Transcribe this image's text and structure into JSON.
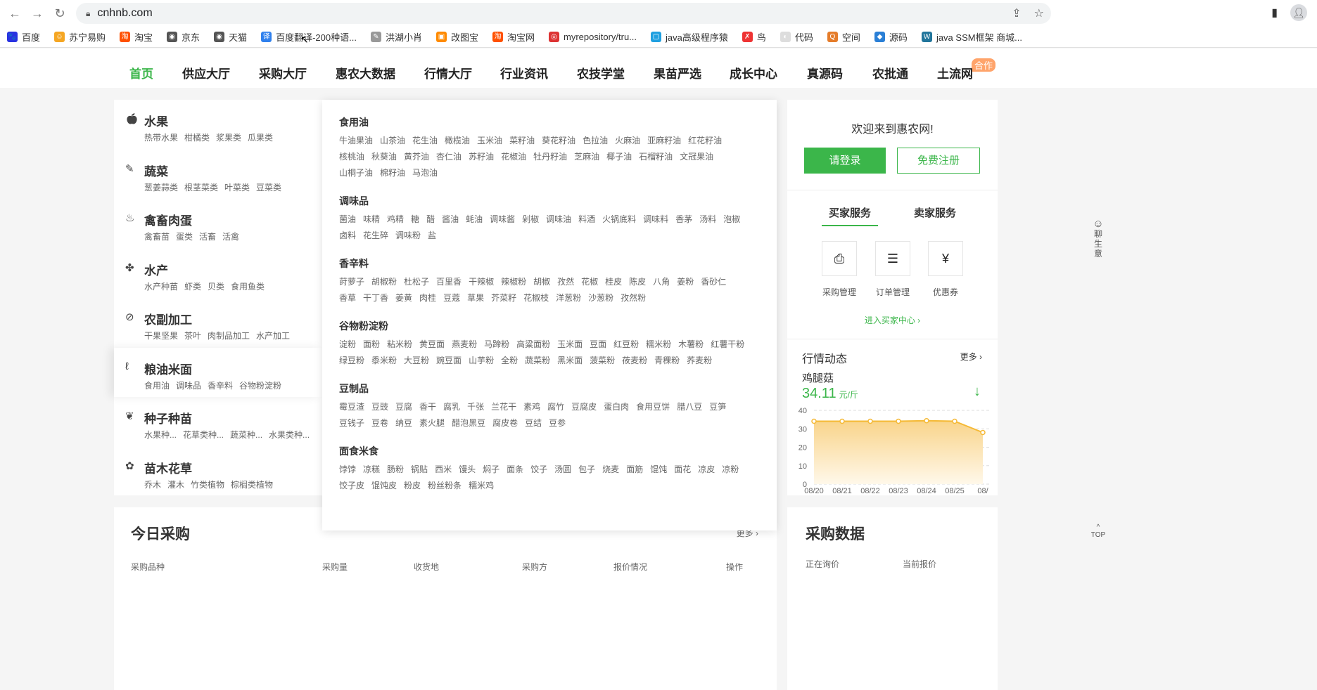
{
  "browser": {
    "url": "cnhnb.com",
    "back": "←",
    "forward": "→",
    "reload": "↻"
  },
  "bookmarks": [
    {
      "label": "百度",
      "color": "#2932e1",
      "glyph": "🐾"
    },
    {
      "label": "苏宁易购",
      "color": "#f5a623",
      "glyph": "☺"
    },
    {
      "label": "淘宝",
      "color": "#ff5000",
      "glyph": "淘"
    },
    {
      "label": "京东",
      "color": "#555555",
      "glyph": "◉"
    },
    {
      "label": "天猫",
      "color": "#555555",
      "glyph": "◉"
    },
    {
      "label": "百度翻译-200种语...",
      "color": "#2f80ed",
      "glyph": "译"
    },
    {
      "label": "洪湖小肖",
      "color": "#999999",
      "glyph": "✎"
    },
    {
      "label": "改图宝",
      "color": "#ff8a00",
      "glyph": "▣"
    },
    {
      "label": "淘宝网",
      "color": "#ff5000",
      "glyph": "淘"
    },
    {
      "label": "myrepository/tru...",
      "color": "#d33",
      "glyph": "◎"
    },
    {
      "label": "java高级程序猿",
      "color": "#20a0e0",
      "glyph": "▢"
    },
    {
      "label": "鸟",
      "color": "#e33",
      "glyph": "✗"
    },
    {
      "label": "代码",
      "color": "#ddd",
      "glyph": "◐"
    },
    {
      "label": "空间",
      "color": "#e57c2a",
      "glyph": "Q"
    },
    {
      "label": "源码",
      "color": "#2a7fd6",
      "glyph": "◆"
    },
    {
      "label": "java SSM框架 商城...",
      "color": "#21759b",
      "glyph": "W"
    }
  ],
  "nav": {
    "items": [
      "首页",
      "供应大厅",
      "采购大厅",
      "惠农大数据",
      "行情大厅",
      "行业资讯",
      "农技学堂",
      "果苗严选",
      "成长中心",
      "真源码",
      "农批通",
      "土流网"
    ],
    "badge": "合作"
  },
  "categories": [
    {
      "title": "水果",
      "icon": "apple-icon",
      "glyph": "🍎︎",
      "subs": [
        "热带水果",
        "柑橘类",
        "浆果类",
        "瓜果类"
      ]
    },
    {
      "title": "蔬菜",
      "icon": "carrot-icon",
      "glyph": "✎",
      "subs": [
        "葱姜蒜类",
        "根茎菜类",
        "叶菜类",
        "豆菜类"
      ]
    },
    {
      "title": "禽畜肉蛋",
      "icon": "chicken-icon",
      "glyph": "♨",
      "subs": [
        "禽畜苗",
        "蛋类",
        "活畜",
        "活禽"
      ]
    },
    {
      "title": "水产",
      "icon": "fish-icon",
      "glyph": "✤",
      "subs": [
        "水产种苗",
        "虾类",
        "贝类",
        "食用鱼类"
      ]
    },
    {
      "title": "农副加工",
      "icon": "nut-icon",
      "glyph": "⊘",
      "subs": [
        "干果坚果",
        "茶叶",
        "肉制品加工",
        "水产加工"
      ]
    },
    {
      "title": "粮油米面",
      "icon": "grain-icon",
      "glyph": "ℓ",
      "subs": [
        "食用油",
        "调味品",
        "香辛料",
        "谷物粉淀粉"
      ]
    },
    {
      "title": "种子种苗",
      "icon": "sprout-icon",
      "glyph": "❦",
      "subs": [
        "水果种...",
        "花草类种...",
        "蔬菜种...",
        "水果类种..."
      ]
    },
    {
      "title": "苗木花草",
      "icon": "flower-icon",
      "glyph": "✿",
      "subs": [
        "乔木",
        "灌木",
        "竹类植物",
        "棕榈类植物"
      ]
    }
  ],
  "dropdown": [
    {
      "title": "食用油",
      "items": [
        "牛油果油",
        "山茶油",
        "花生油",
        "橄榄油",
        "玉米油",
        "菜籽油",
        "葵花籽油",
        "色拉油",
        "火麻油",
        "亚麻籽油",
        "红花籽油",
        "核桃油",
        "秋葵油",
        "黄芥油",
        "杏仁油",
        "苏籽油",
        "花椒油",
        "牡丹籽油",
        "芝麻油",
        "椰子油",
        "石榴籽油",
        "文冠果油",
        "山桐子油",
        "棉籽油",
        "马泡油"
      ]
    },
    {
      "title": "调味品",
      "items": [
        "菌油",
        "味精",
        "鸡精",
        "糖",
        "醋",
        "酱油",
        "蚝油",
        "调味酱",
        "剁椒",
        "调味油",
        "料酒",
        "火锅底料",
        "调味料",
        "香茅",
        "汤料",
        "泡椒",
        "卤料",
        "花生碎",
        "调味粉",
        "盐"
      ]
    },
    {
      "title": "香辛料",
      "items": [
        "莳萝子",
        "胡椒粉",
        "杜松子",
        "百里香",
        "干辣椒",
        "辣椒粉",
        "胡椒",
        "孜然",
        "花椒",
        "桂皮",
        "陈皮",
        "八角",
        "姜粉",
        "香砂仁",
        "香草",
        "干丁香",
        "姜黄",
        "肉桂",
        "豆蔻",
        "草果",
        "芥菜籽",
        "花椒枝",
        "洋葱粉",
        "沙葱粉",
        "孜然粉"
      ]
    },
    {
      "title": "谷物粉淀粉",
      "items": [
        "淀粉",
        "面粉",
        "粘米粉",
        "黄豆面",
        "燕麦粉",
        "马蹄粉",
        "高粱面粉",
        "玉米面",
        "豆面",
        "红豆粉",
        "糯米粉",
        "木薯粉",
        "红薯干粉",
        "绿豆粉",
        "黍米粉",
        "大豆粉",
        "豌豆面",
        "山芋粉",
        "全粉",
        "蔬菜粉",
        "黑米面",
        "菠菜粉",
        "莜麦粉",
        "青稞粉",
        "荞麦粉"
      ]
    },
    {
      "title": "豆制品",
      "items": [
        "霉豆渣",
        "豆豉",
        "豆腐",
        "香干",
        "腐乳",
        "千张",
        "兰花干",
        "素鸡",
        "腐竹",
        "豆腐皮",
        "蛋白肉",
        "食用豆饼",
        "腊八豆",
        "豆笋",
        "豆钱子",
        "豆卷",
        "纳豆",
        "素火腿",
        "醋泡黑豆",
        "腐皮卷",
        "豆结",
        "豆参"
      ]
    },
    {
      "title": "面食米食",
      "items": [
        "饽饽",
        "凉糕",
        "肠粉",
        "锅贴",
        "西米",
        "馒头",
        "焖子",
        "面条",
        "饺子",
        "汤圆",
        "包子",
        "烧麦",
        "面筋",
        "馄饨",
        "面花",
        "凉皮",
        "凉粉",
        "饺子皮",
        "馄饨皮",
        "粉皮",
        "粉丝粉条",
        "糯米鸡"
      ]
    }
  ],
  "user": {
    "welcome": "欢迎来到惠农网!",
    "login": "请登录",
    "register": "免费注册"
  },
  "services": {
    "tabs": [
      "买家服务",
      "卖家服务"
    ],
    "items": [
      {
        "label": "采购管理",
        "glyph": "⎙"
      },
      {
        "label": "订单管理",
        "glyph": "☰"
      },
      {
        "label": "优惠券",
        "glyph": "¥"
      }
    ],
    "enter": "进入买家中心 ›"
  },
  "market": {
    "title": "行情动态",
    "more": "更多 ›",
    "product": "鸡腿菇",
    "price": "34.11",
    "unit": "元/斤",
    "trend": "↓"
  },
  "chart_data": {
    "type": "area",
    "x": [
      "08/20",
      "08/21",
      "08/22",
      "08/23",
      "08/24",
      "08/25",
      "08/"
    ],
    "values": [
      34.1,
      34.1,
      34.1,
      34.1,
      34.4,
      34.1,
      28
    ],
    "ylim": [
      0,
      40
    ],
    "yticks": [
      "0",
      "10",
      "20",
      "30",
      "40"
    ],
    "grid": true,
    "color": "#f5b935"
  },
  "today": {
    "title": "今日采购",
    "more": "更多 ›",
    "columns": [
      "采购品种",
      "采购量",
      "收货地",
      "采购方",
      "报价情况",
      "操作"
    ]
  },
  "purchase_data": {
    "title": "采购数据",
    "columns": [
      "正在询价",
      "当前报价"
    ]
  },
  "side": {
    "chat": "聊生意",
    "top": "TOP"
  }
}
